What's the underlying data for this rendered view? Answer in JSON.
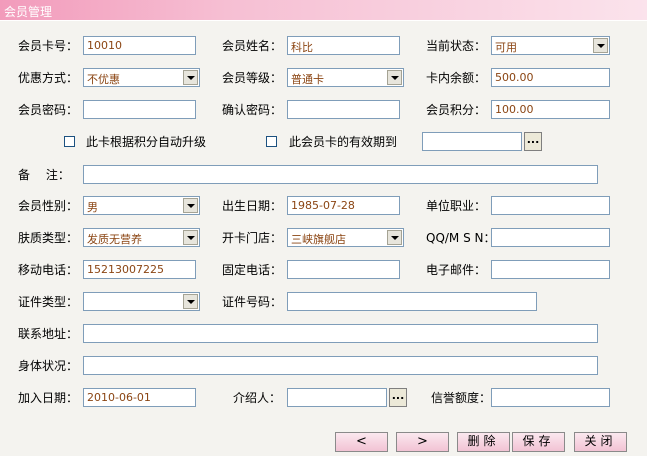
{
  "window": {
    "title": "会员管理"
  },
  "labels": {
    "card_no": "会员卡号：",
    "name": "会员姓名：",
    "status": "当前状态：",
    "discount": "优惠方式：",
    "level": "会员等级：",
    "balance": "卡内余额：",
    "password": "会员密码：",
    "confirm_password": "确认密码：",
    "points": "会员积分：",
    "auto_upgrade": "此卡根据积分自动升级",
    "valid_until": "此会员卡的有效期到",
    "remark": "备　 注：",
    "gender": "会员性别：",
    "birthday": "出生日期：",
    "occupation": "单位职业：",
    "skin_type": "肤质类型：",
    "store": "开卡门店：",
    "qq_msn": "QQ/M S N：",
    "mobile": "移动电话：",
    "phone": "固定电话：",
    "email": "电子邮件：",
    "id_type": "证件类型：",
    "id_no": "证件号码：",
    "address": "联系地址：",
    "health": "身体状况：",
    "join_date": "加入日期：",
    "referrer": "介绍人：",
    "credit": "信誉额度："
  },
  "values": {
    "card_no": "10010",
    "name": "科比",
    "status": "可用",
    "discount": "不优惠",
    "level": "普通卡",
    "balance": "500.00",
    "password": "",
    "confirm_password": "",
    "points": "100.00",
    "valid_until": "",
    "remark": "",
    "gender": "男",
    "birthday": "1985-07-28",
    "occupation": "",
    "skin_type": "发质无营养",
    "store": "三峡旗舰店",
    "qq_msn": "",
    "mobile": "15213007225",
    "phone": "",
    "email": "",
    "id_type": "",
    "id_no": "",
    "address": "",
    "health": "",
    "join_date": "2010-06-01",
    "referrer": "",
    "credit": ""
  },
  "checkboxes": {
    "auto_upgrade": false,
    "valid_until": false
  },
  "buttons": {
    "ellipsis": "...",
    "prev": "<",
    "next": ">",
    "delete": "删除",
    "save": "保存",
    "close": "关闭"
  },
  "colors": {
    "title_bar": "#f29bbb",
    "value_text": "#8b4513",
    "button": "#f2c3d4"
  }
}
